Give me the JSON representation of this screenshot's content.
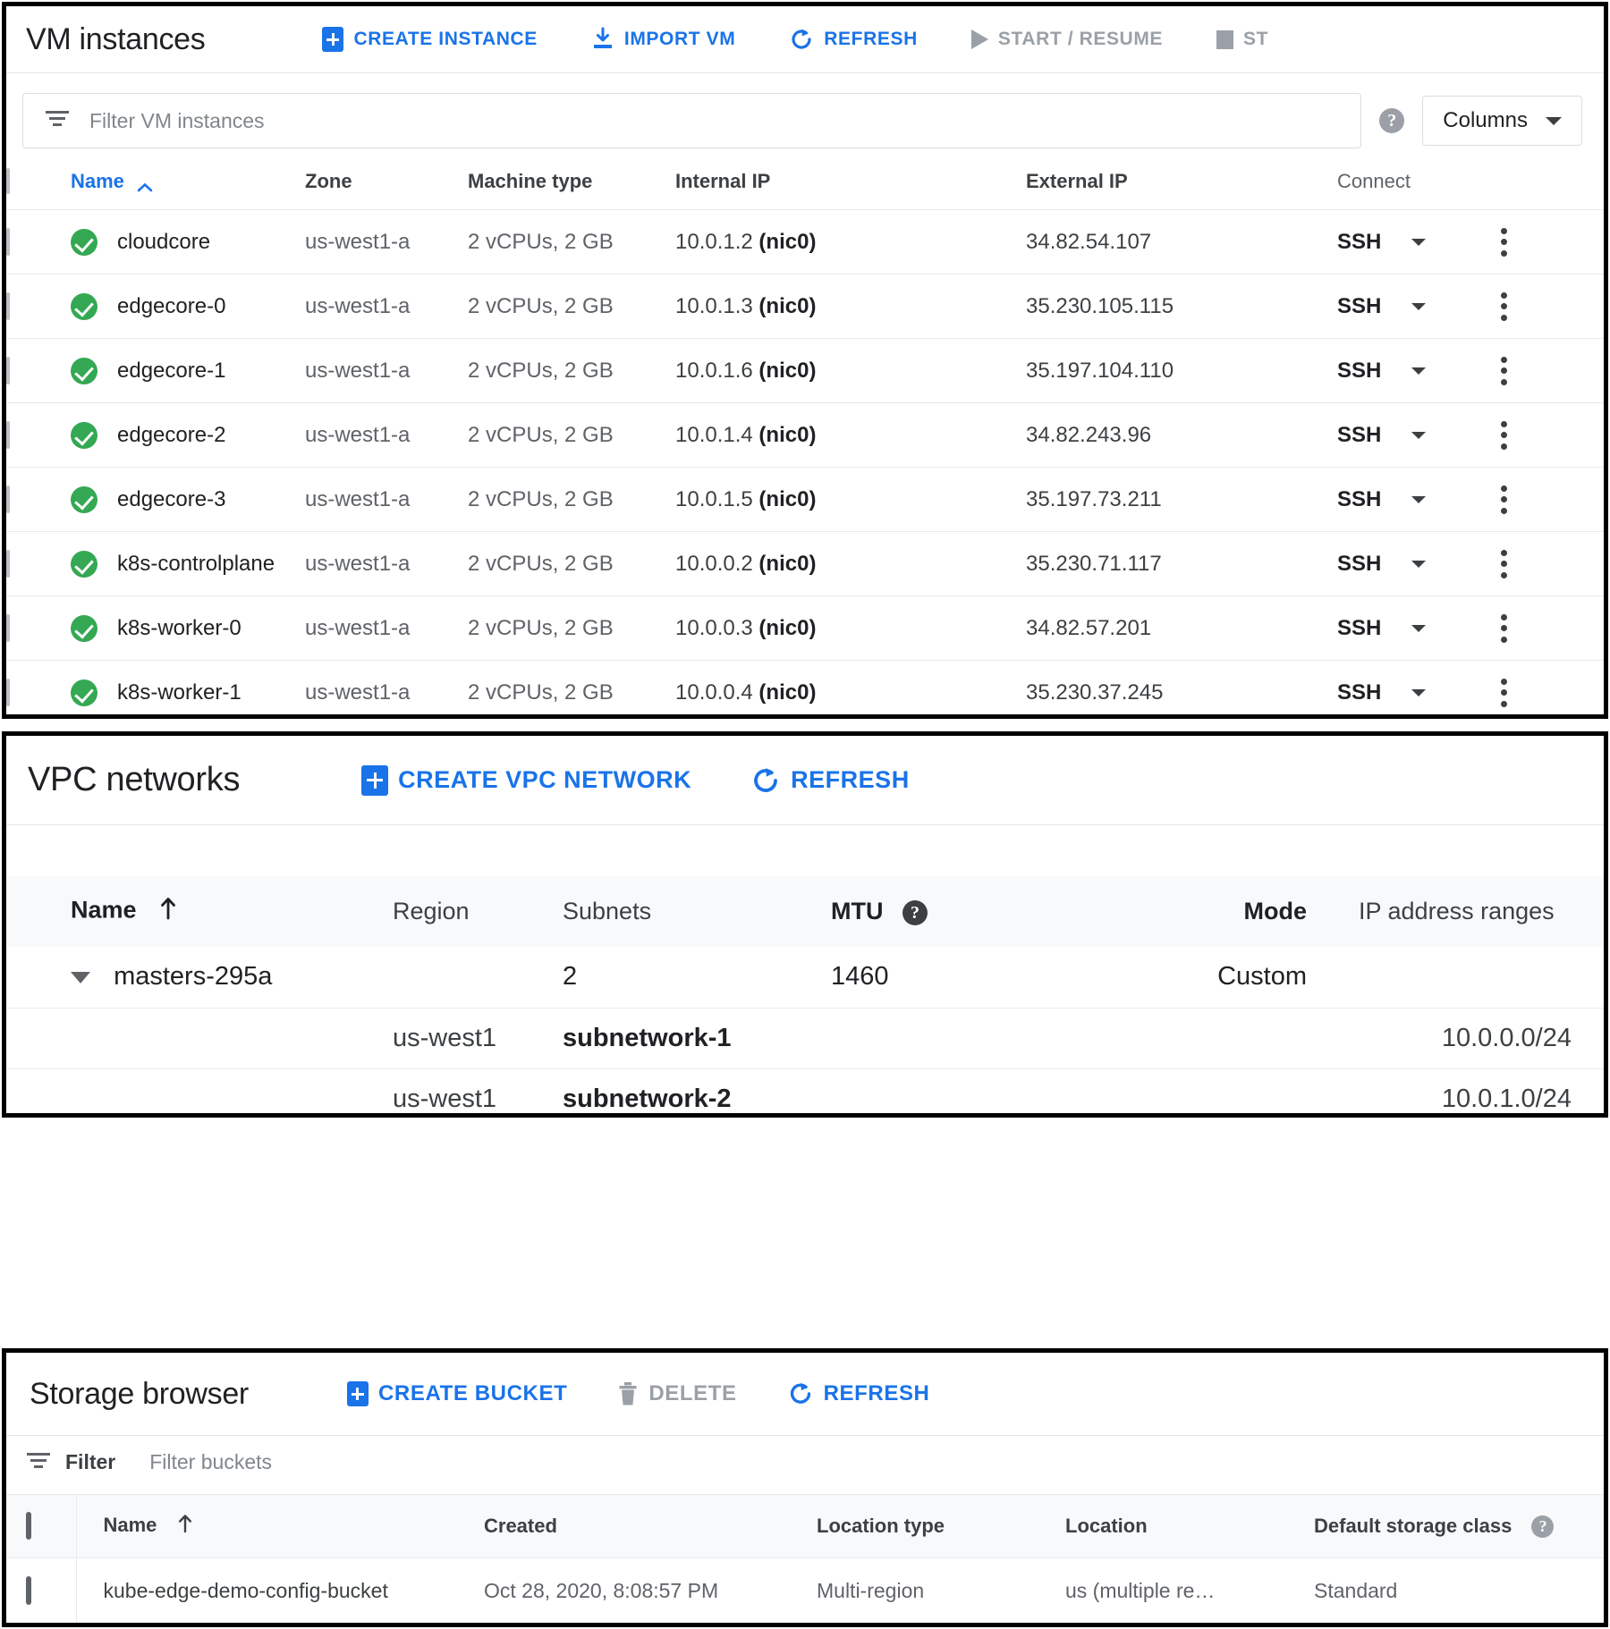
{
  "vm_panel": {
    "title": "VM instances",
    "toolbar": [
      {
        "label": "CREATE INSTANCE",
        "icon": "plus-box-icon",
        "enabled": true
      },
      {
        "label": "IMPORT VM",
        "icon": "import-icon",
        "enabled": true
      },
      {
        "label": "REFRESH",
        "icon": "refresh-icon",
        "enabled": true
      },
      {
        "label": "START / RESUME",
        "icon": "play-icon",
        "enabled": false
      },
      {
        "label": "ST",
        "icon": "stop-icon",
        "enabled": false
      }
    ],
    "filter": {
      "placeholder": "Filter VM instances",
      "icon": "filter-icon",
      "help_icon": "help-icon",
      "columns_label": "Columns",
      "columns_caret": "chevron-down-icon"
    },
    "columns": [
      "Name",
      "Zone",
      "Machine type",
      "Internal IP",
      "External IP",
      "Connect"
    ],
    "sort_column": "Name",
    "sort_direction": "ascending",
    "connect_label": "SSH",
    "rows": [
      {
        "status": "running",
        "name": "cloudcore",
        "zone": "us-west1-a",
        "machine_type": "2 vCPUs, 2 GB",
        "internal_ip": "10.0.1.2",
        "nic": "(nic0)",
        "external_ip": "34.82.54.107"
      },
      {
        "status": "running",
        "name": "edgecore-0",
        "zone": "us-west1-a",
        "machine_type": "2 vCPUs, 2 GB",
        "internal_ip": "10.0.1.3",
        "nic": "(nic0)",
        "external_ip": "35.230.105.115"
      },
      {
        "status": "running",
        "name": "edgecore-1",
        "zone": "us-west1-a",
        "machine_type": "2 vCPUs, 2 GB",
        "internal_ip": "10.0.1.6",
        "nic": "(nic0)",
        "external_ip": "35.197.104.110"
      },
      {
        "status": "running",
        "name": "edgecore-2",
        "zone": "us-west1-a",
        "machine_type": "2 vCPUs, 2 GB",
        "internal_ip": "10.0.1.4",
        "nic": "(nic0)",
        "external_ip": "34.82.243.96"
      },
      {
        "status": "running",
        "name": "edgecore-3",
        "zone": "us-west1-a",
        "machine_type": "2 vCPUs, 2 GB",
        "internal_ip": "10.0.1.5",
        "nic": "(nic0)",
        "external_ip": "35.197.73.211"
      },
      {
        "status": "running",
        "name": "k8s-controlplane",
        "zone": "us-west1-a",
        "machine_type": "2 vCPUs, 2 GB",
        "internal_ip": "10.0.0.2",
        "nic": "(nic0)",
        "external_ip": "35.230.71.117"
      },
      {
        "status": "running",
        "name": "k8s-worker-0",
        "zone": "us-west1-a",
        "machine_type": "2 vCPUs, 2 GB",
        "internal_ip": "10.0.0.3",
        "nic": "(nic0)",
        "external_ip": "34.82.57.201"
      },
      {
        "status": "running",
        "name": "k8s-worker-1",
        "zone": "us-west1-a",
        "machine_type": "2 vCPUs, 2 GB",
        "internal_ip": "10.0.0.4",
        "nic": "(nic0)",
        "external_ip": "35.230.37.245"
      }
    ]
  },
  "vpc_panel": {
    "title": "VPC networks",
    "toolbar": [
      {
        "label": "CREATE VPC NETWORK",
        "icon": "plus-box-icon",
        "enabled": true
      },
      {
        "label": "REFRESH",
        "icon": "refresh-icon",
        "enabled": true
      }
    ],
    "columns": [
      "Name",
      "Region",
      "Subnets",
      "MTU",
      "Mode",
      "IP address ranges"
    ],
    "sort_column": "Name",
    "sort_direction": "ascending",
    "mtu_help_icon": "help-icon",
    "networks": [
      {
        "name": "masters-295a",
        "region": "",
        "subnets": "2",
        "mtu": "1460",
        "mode": "Custom",
        "ip_range": "",
        "expanded": true,
        "children": [
          {
            "region": "us-west1",
            "subnet": "subnetwork-1",
            "ip_range": "10.0.0.0/24"
          },
          {
            "region": "us-west1",
            "subnet": "subnetwork-2",
            "ip_range": "10.0.1.0/24"
          }
        ]
      }
    ]
  },
  "storage_panel": {
    "title": "Storage browser",
    "toolbar": [
      {
        "label": "CREATE BUCKET",
        "icon": "plus-box-icon",
        "enabled": true
      },
      {
        "label": "DELETE",
        "icon": "trash-icon",
        "enabled": false
      },
      {
        "label": "REFRESH",
        "icon": "refresh-icon",
        "enabled": true
      }
    ],
    "filter": {
      "label": "Filter",
      "placeholder": "Filter buckets",
      "icon": "filter-icon"
    },
    "columns": [
      "Name",
      "Created",
      "Location type",
      "Location",
      "Default storage class"
    ],
    "sort_column": "Name",
    "sort_direction": "ascending",
    "storage_class_help_icon": "help-icon",
    "buckets": [
      {
        "name": "kube-edge-demo-config-bucket",
        "created": "Oct 28, 2020, 8:08:57 PM",
        "location_type": "Multi-region",
        "location": "us (multiple re…",
        "storage_class": "Standard"
      }
    ]
  },
  "colors": {
    "accent": "#1a73e8",
    "status_running": "#34a853",
    "text_primary": "#202124",
    "text_secondary": "#5f6368",
    "disabled": "#9aa0a6",
    "header_bg": "#f8f9fa",
    "border": "#e8eaed"
  }
}
